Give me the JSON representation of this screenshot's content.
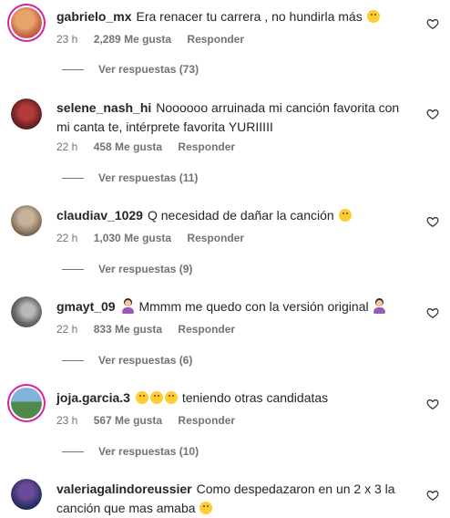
{
  "comments": [
    {
      "username": "gabrielo_mx",
      "text": "Era renacer tu carrera , no hundirla más",
      "emoji": "shushing-face-emoji",
      "time": "23 h",
      "likes": "2,289 Me gusta",
      "reply": "Responder",
      "view_replies": "Ver respuestas (73)",
      "avatar_colors": [
        "#c9684b",
        "#e7a46a"
      ]
    },
    {
      "username": "selene_nash_hi",
      "text": "Noooooo arruinada mi canción favorita con mi canta te, intérprete favorita YURIIIII",
      "time": "22 h",
      "likes": "458 Me gusta",
      "reply": "Responder",
      "view_replies": "Ver respuestas (11)",
      "avatar_colors": [
        "#5a1c1c",
        "#b23a3a"
      ]
    },
    {
      "username": "claudiav_1029",
      "text": "Q necesidad de dañar la canción",
      "emoji": "hushed-face-emoji",
      "time": "22 h",
      "likes": "1,030 Me gusta",
      "reply": "Responder",
      "view_replies": "Ver respuestas (9)",
      "avatar_colors": [
        "#7a6552",
        "#c6b39a"
      ]
    },
    {
      "username": "gmayt_09",
      "emoji_before": "person-gesturing-no-emoji",
      "text": "Mmmm me quedo con la versión original",
      "emoji": "person-shrugging-emoji",
      "time": "22 h",
      "likes": "833 Me gusta",
      "reply": "Responder",
      "view_replies": "Ver respuestas (6)",
      "avatar_colors": [
        "#3a3a3a",
        "#b9b9b9"
      ]
    },
    {
      "username": "joja.garcia.3",
      "emoji_before": "crying-faces-emoji",
      "text": "teniendo otras candidatas",
      "time": "23 h",
      "likes": "567 Me gusta",
      "reply": "Responder",
      "view_replies": "Ver respuestas (10)",
      "avatar_colors": [
        "#7fb3d8",
        "#4f8a4a"
      ]
    },
    {
      "username": "valeriagalindoreussier",
      "text": "Como despedazaron en un 2 x 3 la canción que mas amaba",
      "emoji": "crying-face-emoji",
      "avatar_colors": [
        "#1f2b5a",
        "#6a4a9a"
      ]
    }
  ],
  "colors": {
    "text": "#262626",
    "secondary": "#737373",
    "story_ring": "#d6249f"
  }
}
